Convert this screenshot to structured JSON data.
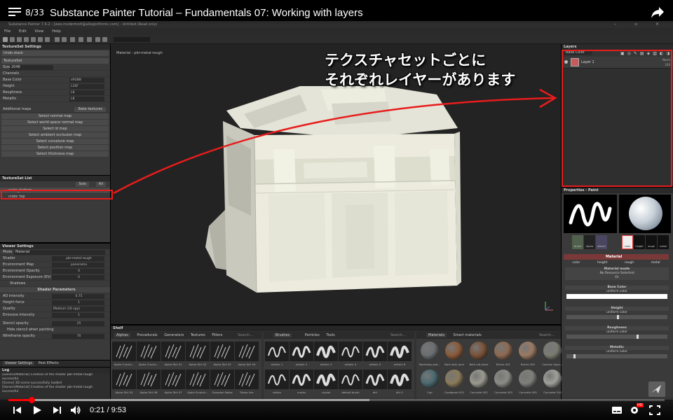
{
  "youtube": {
    "playlist_position": "8/33",
    "video_title": "Substance Painter Tutorial – Fundamentals 07: Working with layers",
    "current_time": "0:21",
    "duration": "9:53",
    "time_separator": "/",
    "progress": 0.035,
    "buffered": 0.55,
    "hd_badge": "HD"
  },
  "app": {
    "title_bar": "Substance Painter 7.4.2 - [wes.mcdermott@allegorithmic.com] - Untitled (Read only)",
    "menu": [
      "File",
      "Edit",
      "View",
      "Help"
    ]
  },
  "textureset_settings": {
    "header": "TextureSet Settings",
    "undo": "Undo stack",
    "textureset": "TextureSet",
    "size_label": "Size",
    "size_value": "2048",
    "channels_label": "Channels",
    "channels": [
      {
        "name": "Base Color",
        "format": "sRGB8"
      },
      {
        "name": "Height",
        "format": "L16F"
      },
      {
        "name": "Roughness",
        "format": "L8"
      },
      {
        "name": "Metallic",
        "format": "L8"
      }
    ],
    "additional_maps": "Additional maps",
    "bake_button": "Bake textures",
    "maps": [
      "Select normal map",
      "Select world space normal map",
      "Select id map",
      "Select ambient occlusion map",
      "Select curvature map",
      "Select position map",
      "Select thickness map"
    ]
  },
  "textureset_list": {
    "header": "TextureSet List",
    "solo": "Solo",
    "all": "All",
    "items": [
      "crate_bottom",
      "crate_top"
    ]
  },
  "viewer_settings": {
    "header": "Viewer Settings",
    "mode_label": "Mode",
    "mode_value": "Material",
    "shader_label": "Shader",
    "shader_value": "pbr-metal-rough",
    "env_map_label": "Environment Map",
    "env_map_value": "panorama",
    "env_opacity_label": "Environment Opacity",
    "env_opacity_value": "0",
    "env_exposure_label": "Environment Exposure (EV)",
    "env_exposure_value": "0",
    "shadows_label": "Shadows",
    "shader_params": "Shader Parameters",
    "ao_label": "AO Intensity",
    "ao_value": "0.75",
    "height_force_label": "Height force",
    "height_force_value": "1",
    "quality_label": "Quality",
    "quality_value": "Medium (16 spp)",
    "emissive_label": "Emissive Intensity",
    "emissive_value": "1",
    "stencil_label": "Stencil opacity",
    "stencil_value": "25",
    "hide_stencil": "Hide stencil when painting",
    "wireframe_label": "Wireframe opacity",
    "wireframe_value": "70",
    "tabs": [
      "Viewer Settings",
      "Post Effects"
    ]
  },
  "log": {
    "header": "Log",
    "lines": [
      "[GenericMaterial] Creation of the shader pbr-metal-rough",
      "successful",
      "[Scene] 3D scene successfully loaded",
      "[GenericMaterial] Creation of the shader pbr-metal-rough",
      "successful"
    ]
  },
  "viewport": {
    "label": "Material - pbr-metal-rough"
  },
  "layers": {
    "header": "Layers",
    "channel_select": "Base Color",
    "layer_name": "Layer 1",
    "blend": "Norm",
    "opacity": "100"
  },
  "properties": {
    "header": "Properties - Paint",
    "brush_slots": [
      "brush",
      "alpha",
      "stencil"
    ],
    "material_slots": [
      "color",
      "height",
      "rough",
      "metal"
    ],
    "material_title": "Material",
    "channel_toggles": [
      "color",
      "height",
      "rough",
      "metal"
    ],
    "material_mode": "Material mode",
    "no_resource": "No Resource Selected",
    "or": "Or",
    "base_color": "Base Color",
    "uniform": "uniform color",
    "height": "Height",
    "roughness": "Roughness",
    "metallic": "Metallic"
  },
  "shelf": {
    "header": "Shelf",
    "alpha_tabs": [
      "Alphas",
      "Procedurals",
      "Generators",
      "Textures",
      "Filters"
    ],
    "search": "Search...",
    "alphas_row1": [
      "Alpha Cracks...",
      "Alpha Cracks...",
      "Alpha Dirt 01",
      "Alpha Dirt 02",
      "Alpha Dirt 03",
      "Alpha Dirt 04"
    ],
    "alphas_row2": [
      "Alpha Dirt 05",
      "Alpha Dirt 06",
      "Alpha Dirt 07",
      "Alpha Scratch...",
      "Gaussian Noise",
      "Sharp line"
    ],
    "brush_tabs": [
      "Brushes",
      "Particles",
      "Tools"
    ],
    "brushes_row1": [
      "artistic 1",
      "artistic 2",
      "artistic 3",
      "artistic 4",
      "artistic 5",
      "artistic 6"
    ],
    "brushes_row2": [
      "cotton",
      "cracks",
      "crystal",
      "default brush",
      "dirt",
      "dirt 2"
    ],
    "material_tabs": [
      "Materials",
      "Smart materials"
    ],
    "materials_row1": [
      "Backdrop pad...",
      "Bark dark pine",
      "Bark old pines",
      "Bricks 001",
      "Bricks 005",
      "Carmen Aspn..."
    ],
    "materials_row2": [
      "Cop",
      "Cardboard 001",
      "Concrete 002",
      "Concrete 003",
      "Concrete 005",
      "Concrete 010"
    ]
  },
  "annotation": {
    "line1": "テクスチャセットごとに",
    "line2": "それぞれレイヤーがあります",
    "color": "#e81c1c"
  }
}
